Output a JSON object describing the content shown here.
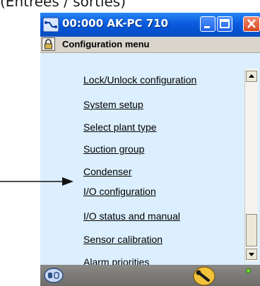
{
  "caption": "(Entrées / sorties)",
  "window": {
    "title": "00:000 AK-PC 710",
    "icons": {
      "app": "network-icon",
      "minimize": "minimize-icon",
      "maximize": "maximize-icon",
      "close": "close-icon"
    }
  },
  "menu": {
    "title": "Configuration menu",
    "lock_icon": "lock-icon",
    "items": [
      {
        "label": "Lock/Unlock configuration"
      },
      {
        "label": "System setup"
      },
      {
        "label": "Select plant type"
      },
      {
        "label": "Suction group"
      },
      {
        "label": "Condenser"
      },
      {
        "label": "I/O configuration"
      },
      {
        "label": "I/O status and manual"
      },
      {
        "label": "Sensor calibration"
      },
      {
        "label": "Alarm priorities"
      }
    ]
  },
  "statusbar": {
    "left_icon": "controller-icon",
    "right_icon": "wrench-icon",
    "indicator_icon": "status-led-icon",
    "indicator_color": "#6fe02d"
  },
  "colors": {
    "titlebar": "#0a5cdd",
    "content_bg": "#dcefff",
    "close_button": "#d6451f"
  }
}
